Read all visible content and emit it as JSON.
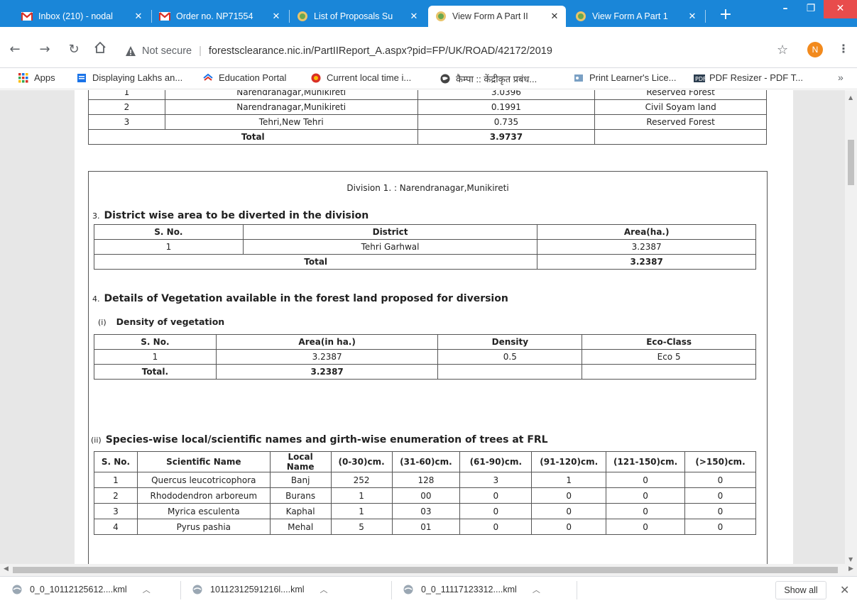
{
  "tabs": [
    {
      "title": "Inbox (210) - nodal",
      "icon": "gmail-icon"
    },
    {
      "title": "Order no. NP71554",
      "icon": "gmail-icon"
    },
    {
      "title": "List of Proposals Su",
      "icon": "moef-icon"
    },
    {
      "title": "View Form A Part II",
      "icon": "moef-icon",
      "active": true
    },
    {
      "title": "View Form A Part 1",
      "icon": "moef-icon"
    }
  ],
  "address": {
    "security": "Not secure",
    "url": "forestsclearance.nic.in/PartIIReport_A.aspx?pid=FP/UK/ROAD/42172/2019"
  },
  "profile_initial": "N",
  "bookmarks": [
    {
      "label": "Apps"
    },
    {
      "label": "Displaying Lakhs an..."
    },
    {
      "label": "Education Portal"
    },
    {
      "label": "Current local time i..."
    },
    {
      "label": "कैम्पा :: केंद्रीकृत प्रबंध..."
    },
    {
      "label": "Print Learner's Lice..."
    },
    {
      "label": "PDF Resizer - PDF T..."
    }
  ],
  "land_table": {
    "rows": [
      [
        "1",
        "Narendranagar,Munikireti",
        "3.0396",
        "Reserved Forest"
      ],
      [
        "2",
        "Narendranagar,Munikireti",
        "0.1991",
        "Civil Soyam land"
      ],
      [
        "3",
        "Tehri,New Tehri",
        "0.735",
        "Reserved Forest"
      ]
    ],
    "total_label": "Total",
    "total_value": "3.9737"
  },
  "division": {
    "title": "Division 1. : Narendranagar,Munikireti",
    "sec3": {
      "num": "3.",
      "title": "District wise area to be diverted in the division",
      "headers": [
        "S. No.",
        "District",
        "Area(ha.)"
      ],
      "rows": [
        [
          "1",
          "Tehri Garhwal",
          "3.2387"
        ]
      ],
      "total_label": "Total",
      "total_value": "3.2387"
    },
    "sec4": {
      "num": "4.",
      "title": "Details of Vegetation available in the forest land proposed for diversion",
      "sub1": {
        "num": "(i)",
        "title": "Density of vegetation",
        "headers": [
          "S. No.",
          "Area(in ha.)",
          "Density",
          "Eco-Class"
        ],
        "rows": [
          [
            "1",
            "3.2387",
            "0.5",
            "Eco 5"
          ]
        ],
        "total_label": "Total.",
        "total_value": "3.2387"
      },
      "sub2": {
        "num": "(ii)",
        "title": "Species-wise local/scientific names and girth-wise enumeration of trees at FRL",
        "headers": [
          "S. No.",
          "Scientific Name",
          "Local Name",
          "(0-30)cm.",
          "(31-60)cm.",
          "(61-90)cm.",
          "(91-120)cm.",
          "(121-150)cm.",
          "(>150)cm."
        ],
        "rows": [
          [
            "1",
            "Quercus leucotricophora",
            "Banj",
            "252",
            "128",
            "3",
            "1",
            "0",
            "0"
          ],
          [
            "2",
            "Rhododendron arboreum",
            "Burans",
            "1",
            "00",
            "0",
            "0",
            "0",
            "0"
          ],
          [
            "3",
            "Myrica esculenta",
            "Kaphal",
            "1",
            "03",
            "0",
            "0",
            "0",
            "0"
          ],
          [
            "4",
            "Pyrus pashia",
            "Mehal",
            "5",
            "01",
            "0",
            "0",
            "0",
            "0"
          ]
        ]
      }
    }
  },
  "downloads": [
    {
      "name": "0_0_10112125612....kml"
    },
    {
      "name": "10112312591216l....kml"
    },
    {
      "name": "0_0_11117123312....kml"
    }
  ],
  "downloads_show_all": "Show all",
  "colors": {
    "tabstrip": "#1a86d8",
    "page_bg": "#e7e7e7",
    "avatar": "#f28a1d",
    "close_btn": "#e84c4c"
  }
}
